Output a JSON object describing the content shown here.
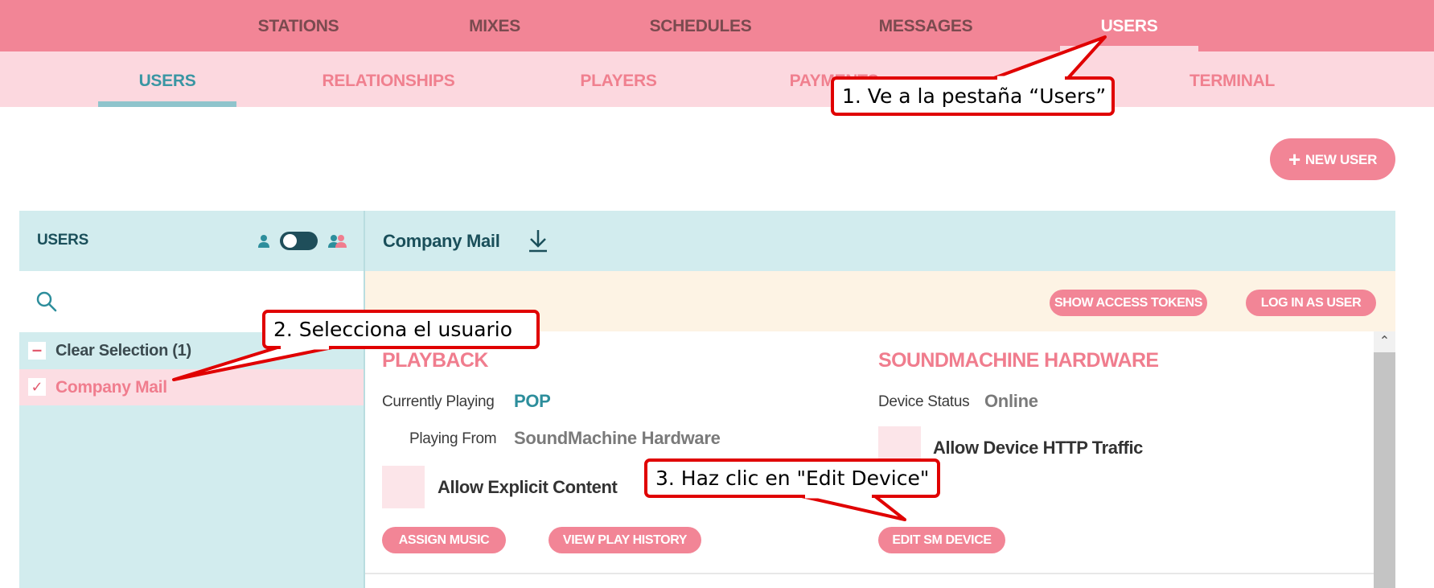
{
  "top_nav": {
    "tabs": [
      "STATIONS",
      "MIXES",
      "SCHEDULES",
      "MESSAGES",
      "USERS"
    ],
    "active": "USERS"
  },
  "sub_nav": {
    "tabs": [
      "USERS",
      "RELATIONSHIPS",
      "PLAYERS",
      "PAYMENTS",
      "TERMINAL"
    ],
    "active": "USERS"
  },
  "new_user_button": {
    "icon": "plus-icon",
    "label": "NEW USER"
  },
  "users_panel": {
    "title": "USERS",
    "icons": [
      "single-user-icon",
      "toggle-switch",
      "group-users-icon"
    ],
    "search": {
      "icon": "search-icon",
      "value": "",
      "placeholder": ""
    },
    "clear_selection": {
      "icon": "minus-icon",
      "label": "Clear Selection (1)"
    },
    "selected_user": {
      "icon": "check-icon",
      "label": "Company Mail"
    }
  },
  "detail": {
    "title": "Company Mail",
    "title_icon": "download-icon",
    "buttons": {
      "access_tokens": "SHOW ACCESS TOKENS",
      "login_as_user": "LOG IN AS USER"
    },
    "playback": {
      "title": "PLAYBACK",
      "currently_playing_label": "Currently Playing",
      "currently_playing_value": "POP",
      "playing_from_label": "Playing From",
      "playing_from_value": "SoundMachine Hardware",
      "explicit_label": "Allow Explicit Content",
      "assign_music": "ASSIGN MUSIC",
      "view_history": "VIEW PLAY HISTORY"
    },
    "hardware": {
      "title": "SOUNDMACHINE HARDWARE",
      "device_status_label": "Device Status",
      "device_status_value": "Online",
      "http_label": "Allow Device HTTP Traffic",
      "edit_device": "EDIT SM DEVICE"
    }
  },
  "callouts": [
    "1. Ve a la pestaña “Users”",
    "2. Selecciona el usuario",
    "3. Haz clic en \"Edit Device\""
  ],
  "colors": {
    "nav_pink": "#f28596",
    "subnav_pink": "#fcd8df",
    "teal_panel": "#d2ecee",
    "accent_teal": "#3a96a3",
    "annotation_red": "#e00000"
  }
}
